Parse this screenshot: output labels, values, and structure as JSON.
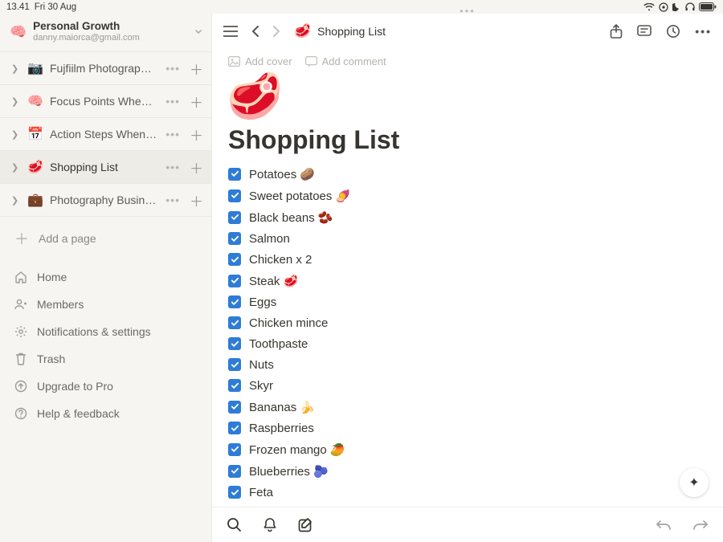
{
  "status": {
    "time": "13.41",
    "date": "Fri 30 Aug"
  },
  "workspace": {
    "icon": "🧠",
    "name": "Personal Growth",
    "email": "danny.maiorca@gmail.com"
  },
  "sidebar_pages": [
    {
      "icon": "📷",
      "label": "Fujfiilm Photography …",
      "active": false
    },
    {
      "icon": "🧠",
      "label": "Focus Points When I'…",
      "active": false
    },
    {
      "icon": "📅",
      "label": "Action Steps When B…",
      "active": false
    },
    {
      "icon": "🥩",
      "label": "Shopping List",
      "active": true
    },
    {
      "icon": "💼",
      "label": "Photography Busines…",
      "active": false
    }
  ],
  "sidebar_add": "Add a page",
  "sidebar_nav": [
    {
      "icon": "home",
      "label": "Home"
    },
    {
      "icon": "members",
      "label": "Members"
    },
    {
      "icon": "settings",
      "label": "Notifications & settings"
    },
    {
      "icon": "trash",
      "label": "Trash"
    },
    {
      "icon": "upgrade",
      "label": "Upgrade to Pro"
    },
    {
      "icon": "help",
      "label": "Help & feedback"
    }
  ],
  "breadcrumb": {
    "icon": "🥩",
    "label": "Shopping List"
  },
  "page_meta": {
    "add_cover": "Add cover",
    "add_comment": "Add comment"
  },
  "page": {
    "icon": "🥩",
    "title": "Shopping List"
  },
  "todos": [
    {
      "text": "Potatoes 🥔",
      "checked": true
    },
    {
      "text": "Sweet potatoes 🍠",
      "checked": true
    },
    {
      "text": "Black beans 🫘",
      "checked": true
    },
    {
      "text": "Salmon",
      "checked": true
    },
    {
      "text": "Chicken x 2",
      "checked": true
    },
    {
      "text": "Steak 🥩",
      "checked": true
    },
    {
      "text": "Eggs",
      "checked": true
    },
    {
      "text": "Chicken mince",
      "checked": true
    },
    {
      "text": "Toothpaste",
      "checked": true
    },
    {
      "text": "Nuts",
      "checked": true
    },
    {
      "text": "Skyr",
      "checked": true
    },
    {
      "text": "Bananas 🍌",
      "checked": true
    },
    {
      "text": "Raspberries",
      "checked": true
    },
    {
      "text": "Frozen mango 🥭",
      "checked": true
    },
    {
      "text": "Blueberries 🫐",
      "checked": true
    },
    {
      "text": "Feta",
      "checked": true
    }
  ]
}
